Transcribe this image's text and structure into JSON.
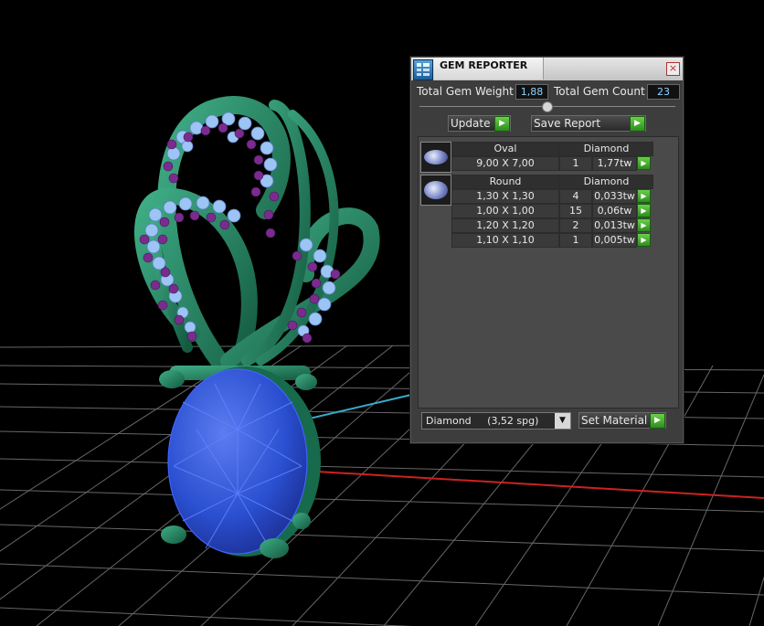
{
  "window": {
    "title": "GEM REPORTER",
    "close_glyph": "×",
    "app_icon": "gem-reporter-app-icon"
  },
  "totals": {
    "weight_label": "Total Gem Weight",
    "weight_value": "1,88",
    "count_label": "Total Gem Count",
    "count_value": "23"
  },
  "actions": {
    "update_label": "Update",
    "save_report_label": "Save Report",
    "play_glyph": "▶"
  },
  "gem_groups": [
    {
      "shape": "Oval",
      "material": "Diamond",
      "rows": [
        {
          "size": "9,00 X 7,00",
          "count": "1",
          "weight": "1,77tw"
        }
      ]
    },
    {
      "shape": "Round",
      "material": "Diamond",
      "rows": [
        {
          "size": "1,30 X 1,30",
          "count": "4",
          "weight": "0,033tw"
        },
        {
          "size": "1,00 X 1,00",
          "count": "15",
          "weight": "0,06tw"
        },
        {
          "size": "1,20 X 1,20",
          "count": "2",
          "weight": "0,013tw"
        },
        {
          "size": "1,10 X 1,10",
          "count": "1",
          "weight": "0,005tw"
        }
      ]
    }
  ],
  "material_select": {
    "value": "Diamond     (3,52 spg)",
    "arrow_glyph": "▼"
  },
  "set_material_label": "Set Material",
  "colors": {
    "metal": "#1f7a5a",
    "sapphire": "#2a4fd0",
    "small_gem_blue": "#9cc4f4",
    "small_gem_purple": "#7a2c8e",
    "value_text": "#8fd4ff",
    "play_green": "#4cb832"
  }
}
